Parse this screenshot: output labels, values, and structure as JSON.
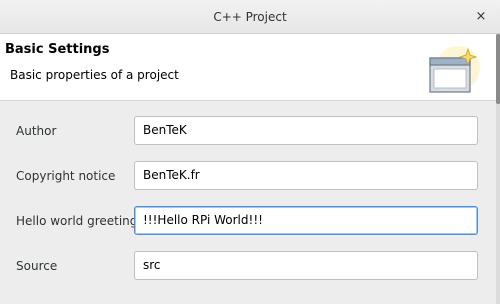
{
  "window": {
    "title": "C++ Project",
    "close_glyph": "×"
  },
  "header": {
    "title": "Basic Settings",
    "description": "Basic properties of a project",
    "graphic_icon": "new-project-wizard-icon"
  },
  "fields": [
    {
      "label": "Author",
      "value": "BenTeK",
      "focused": false
    },
    {
      "label": "Copyright notice",
      "value": "BenTeK.fr",
      "focused": false
    },
    {
      "label": "Hello world greeting",
      "value": "!!!Hello RPi World!!!",
      "focused": true
    },
    {
      "label": "Source",
      "value": "src",
      "focused": false
    }
  ],
  "colors": {
    "focus_border": "#4a90d9",
    "header_bg": "#ffffff",
    "dialog_bg": "#ededed"
  }
}
